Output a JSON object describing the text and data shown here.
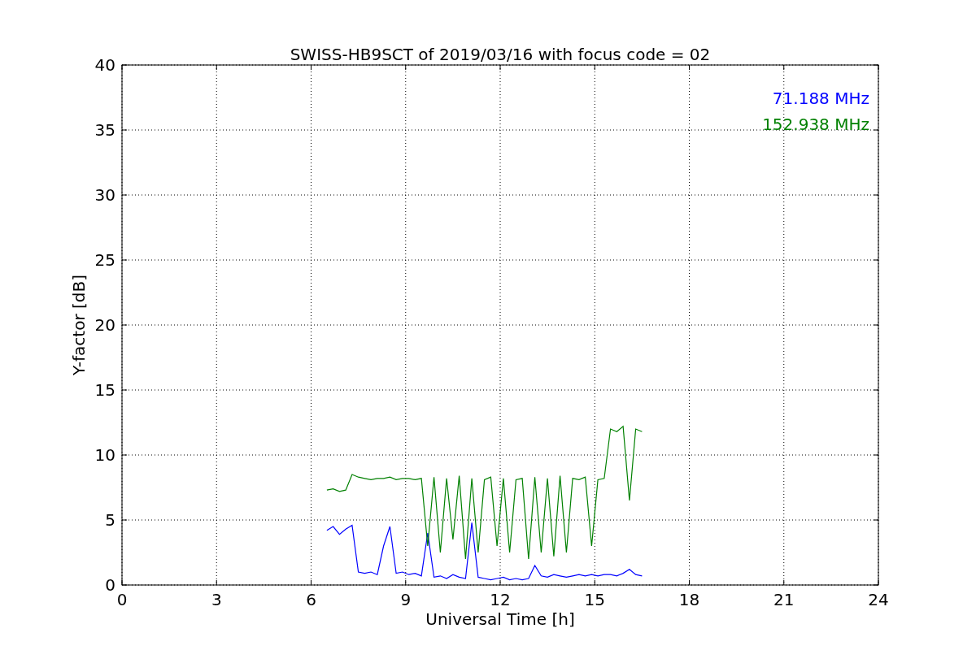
{
  "figure": {
    "chart_data": {
      "type": "line",
      "title": "SWISS-HB9SCT of 2019/03/16 with focus code = 02",
      "xlabel": "Universal Time [h]",
      "ylabel": "Y-factor [dB]",
      "x": [
        6.5,
        6.7,
        6.9,
        7.1,
        7.3,
        7.5,
        7.7,
        7.9,
        8.1,
        8.3,
        8.5,
        8.7,
        8.9,
        9.1,
        9.3,
        9.5,
        9.7,
        9.9,
        10.1,
        10.3,
        10.5,
        10.7,
        10.9,
        11.1,
        11.3,
        11.5,
        11.7,
        11.9,
        12.1,
        12.3,
        12.5,
        12.7,
        12.9,
        13.1,
        13.3,
        13.5,
        13.7,
        13.9,
        14.1,
        14.3,
        14.5,
        14.7,
        14.9,
        15.1,
        15.3,
        15.5,
        15.7,
        15.9,
        16.1,
        16.3,
        16.5
      ],
      "series": [
        {
          "name": "71.188 MHz",
          "color": "#0000ff",
          "values": [
            4.2,
            4.5,
            3.9,
            4.3,
            4.6,
            1.0,
            0.9,
            1.0,
            0.8,
            3.0,
            4.5,
            0.9,
            1.0,
            0.8,
            0.9,
            0.7,
            4.0,
            0.6,
            0.7,
            0.5,
            0.8,
            0.6,
            0.5,
            4.8,
            0.6,
            0.5,
            0.4,
            0.5,
            0.6,
            0.4,
            0.5,
            0.4,
            0.5,
            1.5,
            0.7,
            0.6,
            0.8,
            0.7,
            0.6,
            0.7,
            0.8,
            0.7,
            0.8,
            0.7,
            0.8,
            0.8,
            0.7,
            0.9,
            1.2,
            0.8,
            0.7
          ]
        },
        {
          "name": "152.938 MHz",
          "color": "#008000",
          "values": [
            7.3,
            7.4,
            7.2,
            7.3,
            8.5,
            8.3,
            8.2,
            8.1,
            8.2,
            8.2,
            8.3,
            8.1,
            8.2,
            8.2,
            8.1,
            8.2,
            3.0,
            8.3,
            2.5,
            8.2,
            3.5,
            8.4,
            2.0,
            8.2,
            2.5,
            8.1,
            8.3,
            3.0,
            8.2,
            2.5,
            8.1,
            8.2,
            2.0,
            8.3,
            2.5,
            8.2,
            2.2,
            8.4,
            2.5,
            8.2,
            8.1,
            8.3,
            3.0,
            8.1,
            8.2,
            12.0,
            11.8,
            12.2,
            6.5,
            12.0,
            11.8
          ]
        }
      ],
      "grid": true,
      "xlim": [
        0,
        24
      ],
      "ylim": [
        0,
        40
      ],
      "xticks": [
        0,
        3,
        6,
        9,
        12,
        15,
        18,
        21,
        24
      ],
      "yticks": [
        0,
        5,
        10,
        15,
        20,
        25,
        30,
        35,
        40
      ]
    }
  }
}
